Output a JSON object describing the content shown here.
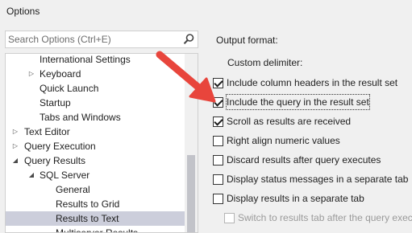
{
  "window": {
    "title": "Options"
  },
  "search": {
    "placeholder": "Search Options (Ctrl+E)"
  },
  "tree": {
    "items": [
      {
        "label": "International Settings",
        "expander": ""
      },
      {
        "label": "Keyboard",
        "expander": "collapsed"
      },
      {
        "label": "Quick Launch",
        "expander": ""
      },
      {
        "label": "Startup",
        "expander": ""
      },
      {
        "label": "Tabs and Windows",
        "expander": ""
      },
      {
        "label": "Text Editor",
        "expander": "collapsed"
      },
      {
        "label": "Query Execution",
        "expander": "collapsed"
      },
      {
        "label": "Query Results",
        "expander": "expanded"
      },
      {
        "label": "SQL Server",
        "expander": "expanded"
      },
      {
        "label": "General",
        "expander": ""
      },
      {
        "label": "Results to Grid",
        "expander": ""
      },
      {
        "label": "Results to Text",
        "expander": "",
        "selected": true
      },
      {
        "label": "Multiserver Results",
        "expander": ""
      }
    ]
  },
  "panel": {
    "heading": "Output format:",
    "custom_delimiter_label": "Custom delimiter:",
    "options": [
      {
        "label": "Include column headers in the result set",
        "checked": true
      },
      {
        "label": "Include the query in the result set",
        "checked": true,
        "focused": true
      },
      {
        "label": "Scroll as results are received",
        "checked": true
      },
      {
        "label": "Right align numeric values",
        "checked": false
      },
      {
        "label": "Discard results after query executes",
        "checked": false
      },
      {
        "label": "Display status messages in a separate tab",
        "checked": false
      },
      {
        "label": "Display results in a separate tab",
        "checked": false
      },
      {
        "label": "Switch to results tab after the query executes",
        "checked": false,
        "disabled": true
      }
    ]
  },
  "colors": {
    "arrow": "#e8453c",
    "selection": "#cccedb"
  }
}
